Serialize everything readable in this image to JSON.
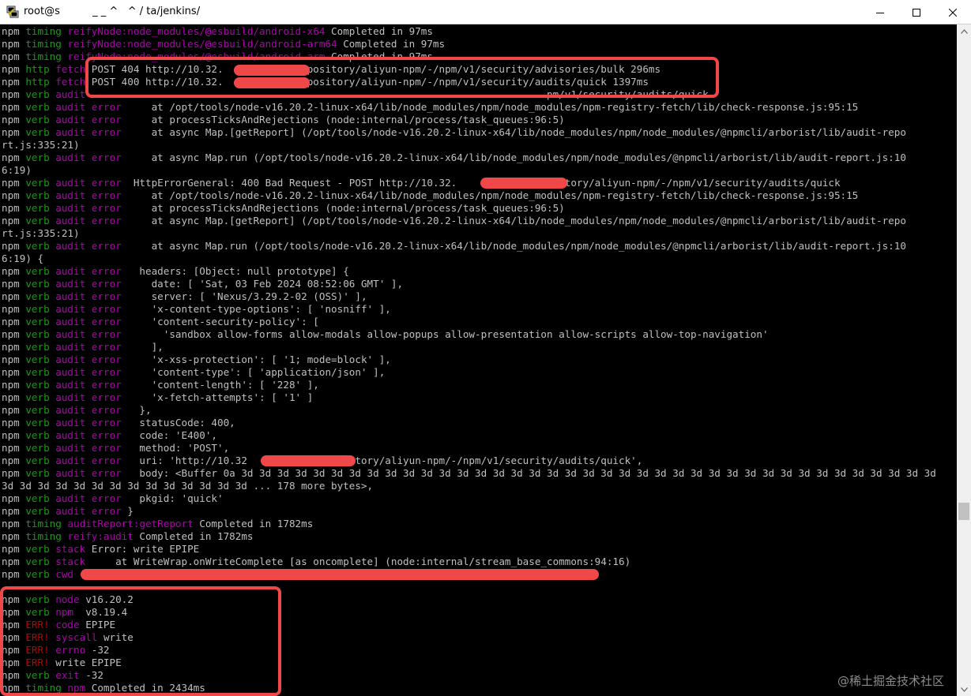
{
  "window": {
    "title": "root@s          _ _ ^   ^ / ta/jenkins/",
    "minimize_glyph": "—",
    "maximize_glyph": "☐",
    "close_glyph": "✕"
  },
  "terminal": {
    "lines": [
      [
        {
          "t": "npm ",
          "c": "white"
        },
        {
          "t": "timing ",
          "c": "green"
        },
        {
          "t": "reifyNode:node_modules/@esbuild/android-x64 ",
          "c": "magenta"
        },
        {
          "t": "Completed in 97ms",
          "c": "white"
        }
      ],
      [
        {
          "t": "npm ",
          "c": "white"
        },
        {
          "t": "timing ",
          "c": "green"
        },
        {
          "t": "reifyNode:node_modules/@esbuild/android-arm64 ",
          "c": "magenta"
        },
        {
          "t": "Completed in 97ms",
          "c": "white"
        }
      ],
      [
        {
          "t": "npm ",
          "c": "white"
        },
        {
          "t": "timing ",
          "c": "green"
        },
        {
          "t": "reifyNode:node_modules/@esbuild/android-arm ",
          "c": "magenta"
        },
        {
          "t": "Completed in 97ms",
          "c": "white"
        }
      ],
      [
        {
          "t": "npm ",
          "c": "white"
        },
        {
          "t": "http ",
          "c": "green"
        },
        {
          "t": "fetch ",
          "c": "magenta"
        },
        {
          "t": "POST 404 http://10.32.           /repository/aliyun-npm/-/npm/v1/security/advisories/bulk 296ms",
          "c": "white"
        }
      ],
      [
        {
          "t": "npm ",
          "c": "white"
        },
        {
          "t": "http ",
          "c": "green"
        },
        {
          "t": "fetch ",
          "c": "magenta"
        },
        {
          "t": "POST 400 http://10.32.           /repository/aliyun-npm/-/npm/v1/security/audits/quick 1397ms",
          "c": "white"
        }
      ],
      [
        {
          "t": "npm ",
          "c": "white"
        },
        {
          "t": "verb ",
          "c": "green"
        },
        {
          "t": "audit ",
          "c": "magenta"
        },
        {
          "t": "                                                                            pm/v1/security/audits/quick",
          "c": "white"
        }
      ],
      [
        {
          "t": "npm ",
          "c": "white"
        },
        {
          "t": "verb ",
          "c": "green"
        },
        {
          "t": "audit error",
          "c": "magenta"
        },
        {
          "t": "     at /opt/tools/node-v16.20.2-linux-x64/lib/node_modules/npm/node_modules/npm-registry-fetch/lib/check-response.js:95:15",
          "c": "white"
        }
      ],
      [
        {
          "t": "npm ",
          "c": "white"
        },
        {
          "t": "verb ",
          "c": "green"
        },
        {
          "t": "audit error",
          "c": "magenta"
        },
        {
          "t": "     at processTicksAndRejections (node:internal/process/task_queues:96:5)",
          "c": "white"
        }
      ],
      [
        {
          "t": "npm ",
          "c": "white"
        },
        {
          "t": "verb ",
          "c": "green"
        },
        {
          "t": "audit error",
          "c": "magenta"
        },
        {
          "t": "     at async Map.[getReport] (/opt/tools/node-v16.20.2-linux-x64/lib/node_modules/npm/node_modules/@npmcli/arborist/lib/audit-repo",
          "c": "white"
        }
      ],
      [
        {
          "t": "rt.js:335:21)",
          "c": "white"
        }
      ],
      [
        {
          "t": "npm ",
          "c": "white"
        },
        {
          "t": "verb ",
          "c": "green"
        },
        {
          "t": "audit error",
          "c": "magenta"
        },
        {
          "t": "     at async Map.run (/opt/tools/node-v16.20.2-linux-x64/lib/node_modules/npm/node_modules/@npmcli/arborist/lib/audit-report.js:10",
          "c": "white"
        }
      ],
      [
        {
          "t": "6:19)",
          "c": "white"
        }
      ],
      [
        {
          "t": "npm ",
          "c": "white"
        },
        {
          "t": "verb ",
          "c": "green"
        },
        {
          "t": "audit error",
          "c": "magenta"
        },
        {
          "t": "  HttpErrorGeneral: 400 Bad Request - POST http://10.32.            repository/aliyun-npm/-/npm/v1/security/audits/quick",
          "c": "white"
        }
      ],
      [
        {
          "t": "npm ",
          "c": "white"
        },
        {
          "t": "verb ",
          "c": "green"
        },
        {
          "t": "audit error",
          "c": "magenta"
        },
        {
          "t": "     at /opt/tools/node-v16.20.2-linux-x64/lib/node_modules/npm/node_modules/npm-registry-fetch/lib/check-response.js:95:15",
          "c": "white"
        }
      ],
      [
        {
          "t": "npm ",
          "c": "white"
        },
        {
          "t": "verb ",
          "c": "green"
        },
        {
          "t": "audit error",
          "c": "magenta"
        },
        {
          "t": "     at processTicksAndRejections (node:internal/process/task_queues:96:5)",
          "c": "white"
        }
      ],
      [
        {
          "t": "npm ",
          "c": "white"
        },
        {
          "t": "verb ",
          "c": "green"
        },
        {
          "t": "audit error",
          "c": "magenta"
        },
        {
          "t": "     at async Map.[getReport] (/opt/tools/node-v16.20.2-linux-x64/lib/node_modules/npm/node_modules/@npmcli/arborist/lib/audit-repo",
          "c": "white"
        }
      ],
      [
        {
          "t": "rt.js:335:21)",
          "c": "white"
        }
      ],
      [
        {
          "t": "npm ",
          "c": "white"
        },
        {
          "t": "verb ",
          "c": "green"
        },
        {
          "t": "audit error",
          "c": "magenta"
        },
        {
          "t": "     at async Map.run (/opt/tools/node-v16.20.2-linux-x64/lib/node_modules/npm/node_modules/@npmcli/arborist/lib/audit-report.js:10",
          "c": "white"
        }
      ],
      [
        {
          "t": "6:19) {",
          "c": "white"
        }
      ],
      [
        {
          "t": "npm ",
          "c": "white"
        },
        {
          "t": "verb ",
          "c": "green"
        },
        {
          "t": "audit error",
          "c": "magenta"
        },
        {
          "t": "   headers: [Object: null prototype] {",
          "c": "white"
        }
      ],
      [
        {
          "t": "npm ",
          "c": "white"
        },
        {
          "t": "verb ",
          "c": "green"
        },
        {
          "t": "audit error",
          "c": "magenta"
        },
        {
          "t": "     date: [ 'Sat, 03 Feb 2024 08:52:06 GMT' ],",
          "c": "white"
        }
      ],
      [
        {
          "t": "npm ",
          "c": "white"
        },
        {
          "t": "verb ",
          "c": "green"
        },
        {
          "t": "audit error",
          "c": "magenta"
        },
        {
          "t": "     server: [ 'Nexus/3.29.2-02 (OSS)' ],",
          "c": "white"
        }
      ],
      [
        {
          "t": "npm ",
          "c": "white"
        },
        {
          "t": "verb ",
          "c": "green"
        },
        {
          "t": "audit error",
          "c": "magenta"
        },
        {
          "t": "     'x-content-type-options': [ 'nosniff' ],",
          "c": "white"
        }
      ],
      [
        {
          "t": "npm ",
          "c": "white"
        },
        {
          "t": "verb ",
          "c": "green"
        },
        {
          "t": "audit error",
          "c": "magenta"
        },
        {
          "t": "     'content-security-policy': [",
          "c": "white"
        }
      ],
      [
        {
          "t": "npm ",
          "c": "white"
        },
        {
          "t": "verb ",
          "c": "green"
        },
        {
          "t": "audit error",
          "c": "magenta"
        },
        {
          "t": "       'sandbox allow-forms allow-modals allow-popups allow-presentation allow-scripts allow-top-navigation'",
          "c": "white"
        }
      ],
      [
        {
          "t": "npm ",
          "c": "white"
        },
        {
          "t": "verb ",
          "c": "green"
        },
        {
          "t": "audit error",
          "c": "magenta"
        },
        {
          "t": "     ],",
          "c": "white"
        }
      ],
      [
        {
          "t": "npm ",
          "c": "white"
        },
        {
          "t": "verb ",
          "c": "green"
        },
        {
          "t": "audit error",
          "c": "magenta"
        },
        {
          "t": "     'x-xss-protection': [ '1; mode=block' ],",
          "c": "white"
        }
      ],
      [
        {
          "t": "npm ",
          "c": "white"
        },
        {
          "t": "verb ",
          "c": "green"
        },
        {
          "t": "audit error",
          "c": "magenta"
        },
        {
          "t": "     'content-type': [ 'application/json' ],",
          "c": "white"
        }
      ],
      [
        {
          "t": "npm ",
          "c": "white"
        },
        {
          "t": "verb ",
          "c": "green"
        },
        {
          "t": "audit error",
          "c": "magenta"
        },
        {
          "t": "     'content-length': [ '228' ],",
          "c": "white"
        }
      ],
      [
        {
          "t": "npm ",
          "c": "white"
        },
        {
          "t": "verb ",
          "c": "green"
        },
        {
          "t": "audit error",
          "c": "magenta"
        },
        {
          "t": "     'x-fetch-attempts': [ '1' ]",
          "c": "white"
        }
      ],
      [
        {
          "t": "npm ",
          "c": "white"
        },
        {
          "t": "verb ",
          "c": "green"
        },
        {
          "t": "audit error",
          "c": "magenta"
        },
        {
          "t": "   },",
          "c": "white"
        }
      ],
      [
        {
          "t": "npm ",
          "c": "white"
        },
        {
          "t": "verb ",
          "c": "green"
        },
        {
          "t": "audit error",
          "c": "magenta"
        },
        {
          "t": "   statusCode: 400,",
          "c": "white"
        }
      ],
      [
        {
          "t": "npm ",
          "c": "white"
        },
        {
          "t": "verb ",
          "c": "green"
        },
        {
          "t": "audit error",
          "c": "magenta"
        },
        {
          "t": "   code: 'E400',",
          "c": "white"
        }
      ],
      [
        {
          "t": "npm ",
          "c": "white"
        },
        {
          "t": "verb ",
          "c": "green"
        },
        {
          "t": "audit error",
          "c": "magenta"
        },
        {
          "t": "   method: 'POST',",
          "c": "white"
        }
      ],
      [
        {
          "t": "npm ",
          "c": "white"
        },
        {
          "t": "verb ",
          "c": "green"
        },
        {
          "t": "audit error",
          "c": "magenta"
        },
        {
          "t": "   uri: 'http://10.32            repository/aliyun-npm/-/npm/v1/security/audits/quick',",
          "c": "white"
        }
      ],
      [
        {
          "t": "npm ",
          "c": "white"
        },
        {
          "t": "verb ",
          "c": "green"
        },
        {
          "t": "audit error",
          "c": "magenta"
        },
        {
          "t": "   body: <Buffer 0a 3d 3d 3d 3d 3d 3d 3d 3d 3d 3d 3d 3d 3d 3d 3d 3d 3d 3d 3d 3d 3d 3d 3d 3d 3d 3d 3d 3d 3d 3d 3d 3d 3d 3d 3d 3d 3d 3d 3d",
          "c": "white"
        }
      ],
      [
        {
          "t": "3d 3d 3d 3d 3d 3d 3d 3d 3d 3d 3d 3d 3d 3d ... 178 more bytes>,",
          "c": "white"
        }
      ],
      [
        {
          "t": "npm ",
          "c": "white"
        },
        {
          "t": "verb ",
          "c": "green"
        },
        {
          "t": "audit error",
          "c": "magenta"
        },
        {
          "t": "   pkgid: 'quick'",
          "c": "white"
        }
      ],
      [
        {
          "t": "npm ",
          "c": "white"
        },
        {
          "t": "verb ",
          "c": "green"
        },
        {
          "t": "audit error",
          "c": "magenta"
        },
        {
          "t": " }",
          "c": "white"
        }
      ],
      [
        {
          "t": "npm ",
          "c": "white"
        },
        {
          "t": "timing ",
          "c": "green"
        },
        {
          "t": "auditReport:getReport ",
          "c": "magenta"
        },
        {
          "t": "Completed in 1782ms",
          "c": "white"
        }
      ],
      [
        {
          "t": "npm ",
          "c": "white"
        },
        {
          "t": "timing ",
          "c": "green"
        },
        {
          "t": "reify:audit ",
          "c": "magenta"
        },
        {
          "t": "Completed in 1782ms",
          "c": "white"
        }
      ],
      [
        {
          "t": "npm ",
          "c": "white"
        },
        {
          "t": "verb ",
          "c": "green"
        },
        {
          "t": "stack ",
          "c": "magenta"
        },
        {
          "t": "Error: write EPIPE",
          "c": "white"
        }
      ],
      [
        {
          "t": "npm ",
          "c": "white"
        },
        {
          "t": "verb ",
          "c": "green"
        },
        {
          "t": "stack ",
          "c": "magenta"
        },
        {
          "t": "    at WriteWrap.onWriteComplete [as oncomplete] (node:internal/stream_base_commons:94:16)",
          "c": "white"
        }
      ],
      [
        {
          "t": "npm ",
          "c": "white"
        },
        {
          "t": "verb ",
          "c": "green"
        },
        {
          "t": "cwd ",
          "c": "magenta"
        },
        {
          "t": "",
          "c": "white"
        }
      ],
      [
        {
          "t": "",
          "c": "white"
        }
      ],
      [
        {
          "t": "npm ",
          "c": "white"
        },
        {
          "t": "verb ",
          "c": "green"
        },
        {
          "t": "node ",
          "c": "magenta"
        },
        {
          "t": "v16.20.2",
          "c": "white"
        }
      ],
      [
        {
          "t": "npm ",
          "c": "white"
        },
        {
          "t": "verb ",
          "c": "green"
        },
        {
          "t": "npm  ",
          "c": "magenta"
        },
        {
          "t": "v8.19.4",
          "c": "white"
        }
      ],
      [
        {
          "t": "npm ",
          "c": "white"
        },
        {
          "t": "ERR! ",
          "c": "red"
        },
        {
          "t": "code ",
          "c": "magenta"
        },
        {
          "t": "EPIPE",
          "c": "white"
        }
      ],
      [
        {
          "t": "npm ",
          "c": "white"
        },
        {
          "t": "ERR! ",
          "c": "red"
        },
        {
          "t": "syscall ",
          "c": "magenta"
        },
        {
          "t": "write",
          "c": "white"
        }
      ],
      [
        {
          "t": "npm ",
          "c": "white"
        },
        {
          "t": "ERR! ",
          "c": "red"
        },
        {
          "t": "errno ",
          "c": "magenta"
        },
        {
          "t": "-32",
          "c": "white"
        }
      ],
      [
        {
          "t": "npm ",
          "c": "white"
        },
        {
          "t": "ERR! ",
          "c": "red"
        },
        {
          "t": "write EPIPE",
          "c": "white"
        }
      ],
      [
        {
          "t": "npm ",
          "c": "white"
        },
        {
          "t": "verb ",
          "c": "green"
        },
        {
          "t": "exit ",
          "c": "magenta"
        },
        {
          "t": "-32",
          "c": "white"
        }
      ],
      [
        {
          "t": "npm ",
          "c": "white"
        },
        {
          "t": "timing ",
          "c": "green"
        },
        {
          "t": "npm ",
          "c": "magenta"
        },
        {
          "t": "Completed in 2434ms",
          "c": "white"
        }
      ]
    ]
  },
  "watermark": "@稀土掘金技术社区",
  "colors": {
    "terminal_bg": "#000000",
    "text": "#c0c0c0",
    "green": "#10a010",
    "magenta": "#b000b0",
    "red": "#c00000",
    "annotation": "#f04848"
  }
}
